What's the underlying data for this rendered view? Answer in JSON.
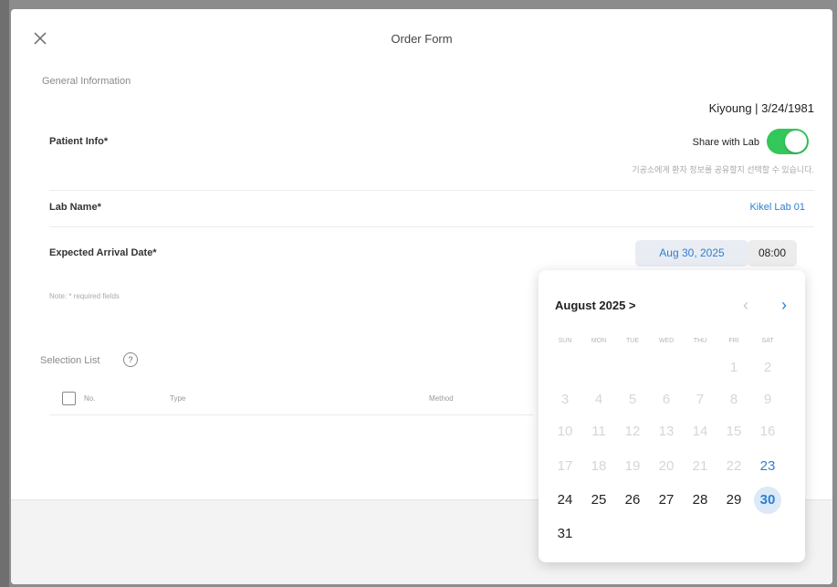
{
  "modal": {
    "title": "Order Form",
    "close_icon": "close-icon"
  },
  "general": {
    "label": "General Information",
    "patient_label": "Patient Info*",
    "patient_value": "Kiyoung | 3/24/1981",
    "share_label": "Share with Lab",
    "share_on": true,
    "share_hint": "기공소에게 환자 정보를 공유할지 선택할 수 있습니다.",
    "lab_label": "Lab Name*",
    "lab_value": "Kikel Lab 01",
    "date_label": "Expected Arrival Date*",
    "date_value": "Aug 30, 2025",
    "time_value": "08:00",
    "note": "Note: * required fields"
  },
  "selection": {
    "label": "Selection List",
    "help_icon": "question-circle-icon",
    "columns": [
      "No.",
      "Type",
      "Method"
    ]
  },
  "calendar": {
    "month_label": "August 2025 >",
    "prev_icon": "chevron-left-icon",
    "next_icon": "chevron-right-icon",
    "weekdays": [
      "SUN",
      "MON",
      "TUE",
      "WED",
      "THU",
      "FRI",
      "SAT"
    ],
    "selected_day": "30",
    "colors": {
      "accent": "#2d7fd0",
      "toggle_on": "#34c759",
      "selected_bg": "#dbe9f8"
    },
    "weeks": [
      [
        "",
        "",
        "",
        "",
        "",
        "1",
        "2"
      ],
      [
        "3",
        "4",
        "5",
        "6",
        "7",
        "8",
        "9"
      ],
      [
        "10",
        "11",
        "12",
        "13",
        "14",
        "15",
        "16"
      ],
      [
        "17",
        "18",
        "19",
        "20",
        "21",
        "22",
        "23"
      ],
      [
        "24",
        "25",
        "26",
        "27",
        "28",
        "29",
        "30"
      ],
      [
        "31",
        "",
        "",
        "",
        "",
        "",
        ""
      ]
    ],
    "enabled_days": [
      "23",
      "24",
      "25",
      "26",
      "27",
      "28",
      "29",
      "30",
      "31"
    ]
  }
}
